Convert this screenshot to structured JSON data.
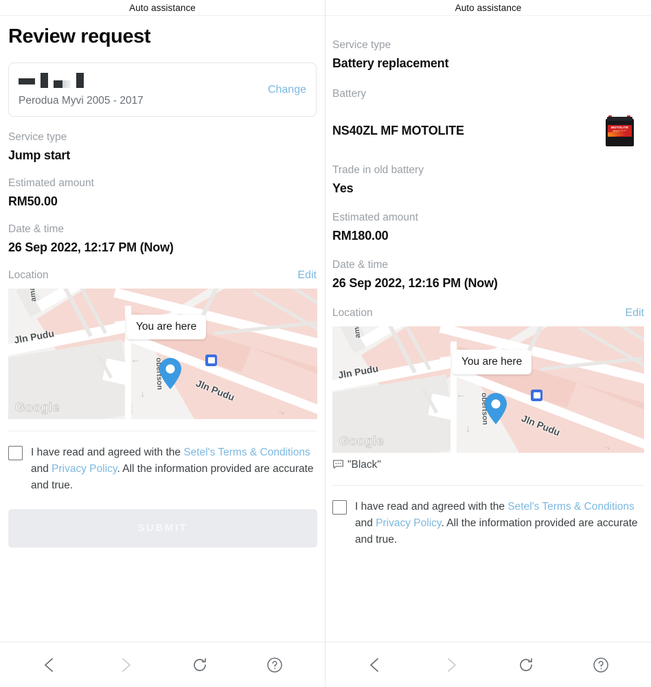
{
  "left": {
    "titlebar": {
      "title": "Auto assistance"
    },
    "page_title": "Review request",
    "vehicle": {
      "plate_redacted": true,
      "name": "Perodua Myvi 2005 - 2017",
      "change_label": "Change"
    },
    "fields": [
      {
        "label": "Service type",
        "value": "Jump start"
      },
      {
        "label": "Estimated amount",
        "value": "RM50.00"
      },
      {
        "label": "Date & time",
        "value": "26 Sep 2022, 12:17 PM (Now)"
      }
    ],
    "location": {
      "label": "Location",
      "edit_label": "Edit",
      "map": {
        "tooltip": "You are here",
        "attribution": "Google",
        "street_labels": [
          "Jln Pudu",
          "obertson",
          "Jln Pudu",
          "ama"
        ]
      }
    },
    "terms": {
      "prefix": "I have read and agreed with the ",
      "link1": "Setel's Terms & Conditions",
      "middle": " and ",
      "link2": "Privacy Policy",
      "suffix": ". All the information provided are accurate and true.",
      "checked": false
    },
    "submit_label": "SUBMIT"
  },
  "right": {
    "titlebar": {
      "title": "Auto assistance"
    },
    "fields": [
      {
        "label": "Service type",
        "value": "Battery replacement"
      },
      {
        "label": "Battery",
        "value": "NS40ZL MF MOTOLITE"
      },
      {
        "label": "Trade in old battery",
        "value": "Yes"
      },
      {
        "label": "Estimated amount",
        "value": "RM180.00"
      },
      {
        "label": "Date & time",
        "value": "26 Sep 2022, 12:16 PM (Now)"
      }
    ],
    "battery_thumb": {
      "brand": "MOTOLITE",
      "sub": "HEAVY DUTY"
    },
    "location": {
      "label": "Location",
      "edit_label": "Edit",
      "map": {
        "tooltip": "You are here",
        "attribution": "Google",
        "street_labels": [
          "Jln Pudu",
          "obertson",
          "Jln Pudu",
          "ama"
        ]
      }
    },
    "note": "\"Black\"",
    "terms": {
      "prefix": "I have read and agreed with the ",
      "link1": "Setel's Terms & Conditions",
      "middle": " and ",
      "link2": "Privacy Policy",
      "suffix": ". All the information provided are accurate and true.",
      "checked": false
    }
  },
  "navbar": {
    "back": "back-chevron",
    "forward": "forward-chevron",
    "reload": "reload-arrow",
    "help": "question-circle"
  },
  "colors": {
    "link": "#7cb8e0",
    "label": "#9aa0a6",
    "value": "#111111",
    "pin": "#3b9ae1",
    "submit_bg": "#e9ebee",
    "map_pink": "#f6d9d3",
    "battery_red": "#cf2222"
  }
}
